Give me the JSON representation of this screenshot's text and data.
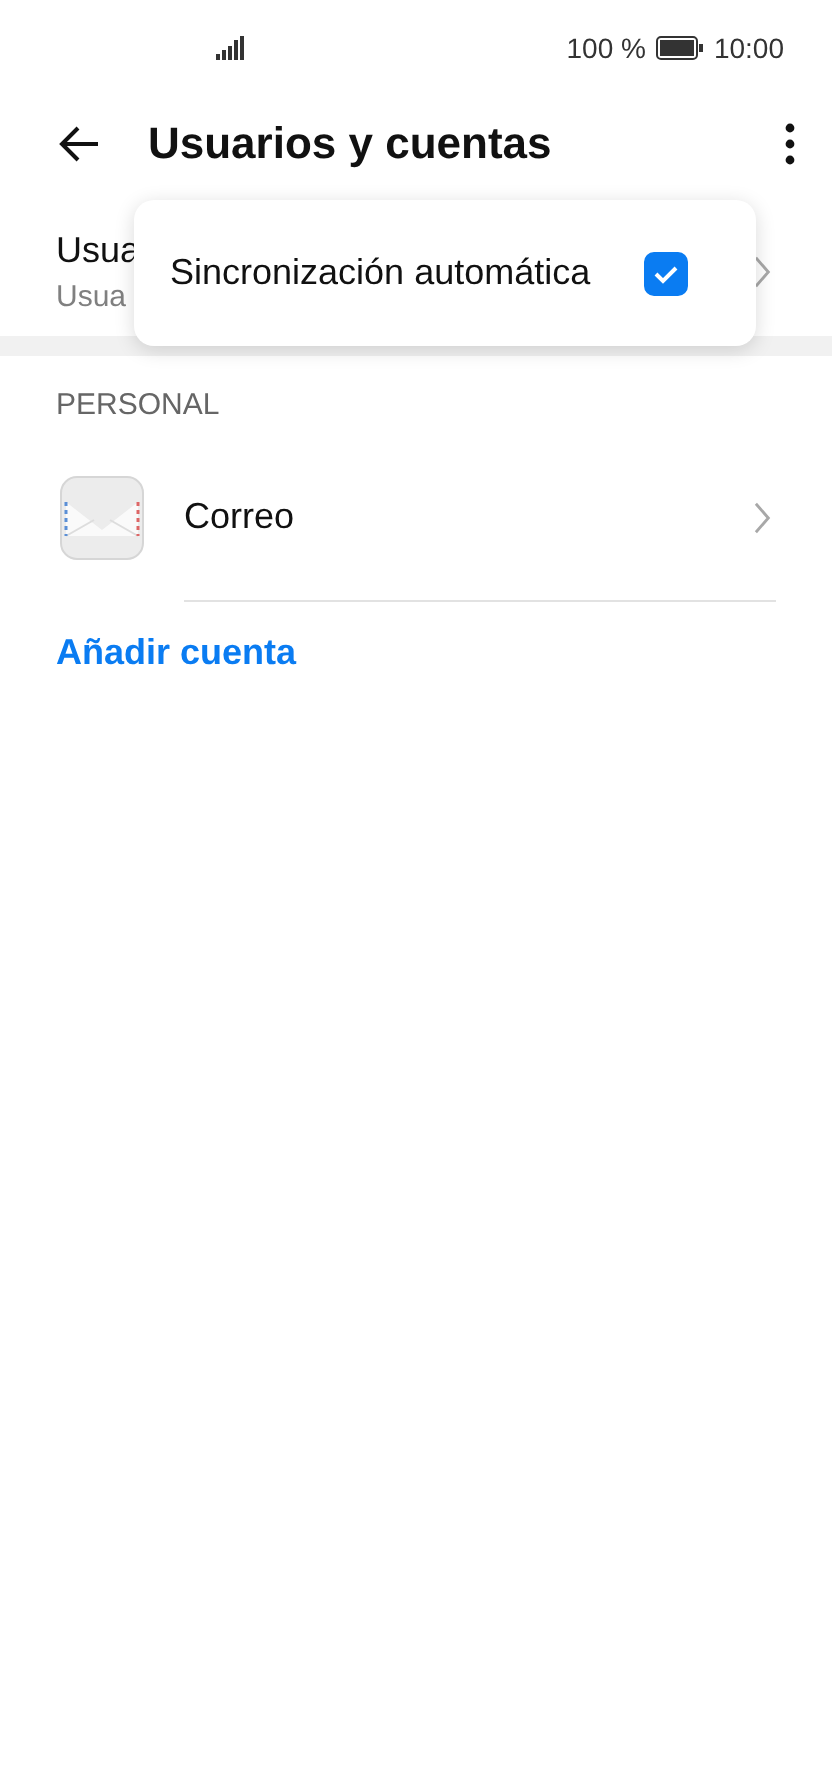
{
  "status_bar": {
    "battery_text": "100 %",
    "time": "10:00"
  },
  "header": {
    "title": "Usuarios y cuentas"
  },
  "partial_row": {
    "title": "Usua",
    "subtitle": "Usua"
  },
  "menu": {
    "items": [
      {
        "label": "Sincronización automática",
        "checked": true
      }
    ]
  },
  "section": {
    "heading": "PERSONAL",
    "accounts": [
      {
        "label": "Correo"
      }
    ],
    "add_link": "Añadir cuenta"
  }
}
